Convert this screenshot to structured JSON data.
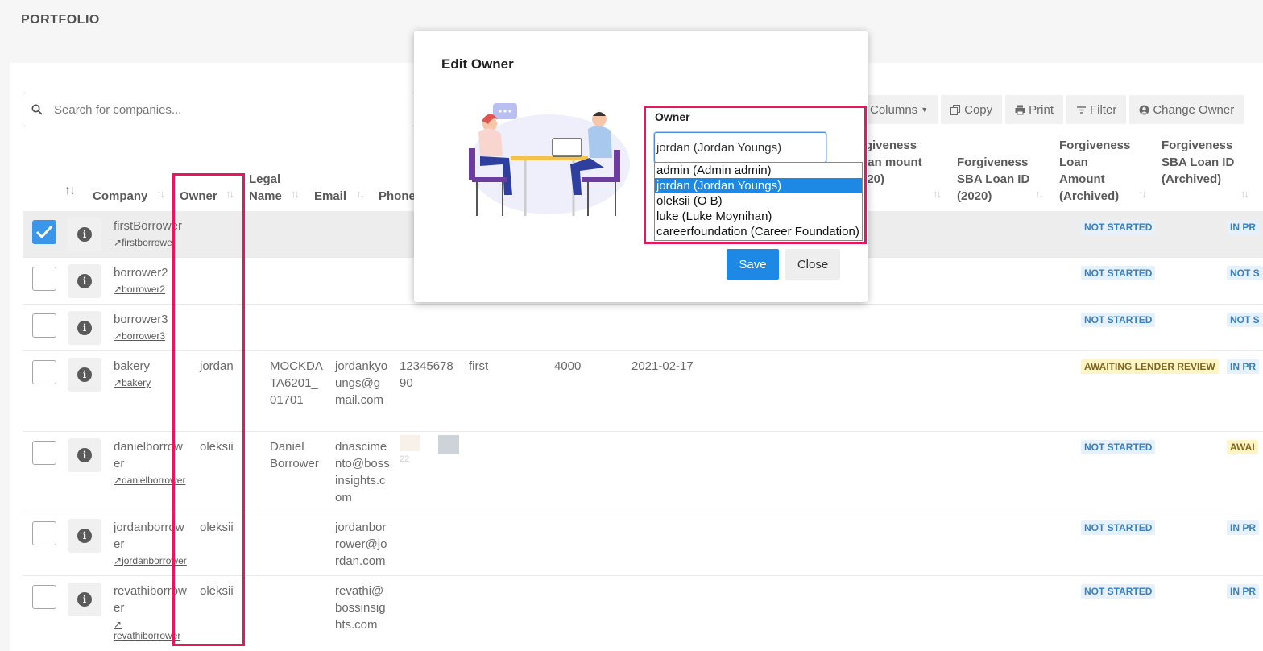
{
  "page": {
    "title": "PORTFOLIO"
  },
  "search": {
    "placeholder": "Search for companies..."
  },
  "toolbar": {
    "columns": "Columns",
    "copy": "Copy",
    "print": "Print",
    "filter": "Filter",
    "change_owner": "Change Owner"
  },
  "headers": {
    "company": "Company",
    "owner": "Owner",
    "legal_name": "Legal Name",
    "email": "Email",
    "phone": "Phone",
    "forgiveness_loan_amount_2020": "rgiveness oan mount 020)",
    "forgiveness_sba_loan_id_2020": "Forgiveness SBA Loan ID (2020)",
    "forgiveness_loan_amount_archived": "Forgiveness Loan Amount (Archived)",
    "forgiveness_sba_loan_id_archived": "Forgiveness SBA Loan ID (Archived)"
  },
  "rows": [
    {
      "company": "firstBorrower",
      "link": "firstborrowe",
      "owner": "",
      "legal_name": "",
      "email": "",
      "phone": "",
      "col6": "",
      "col7": "",
      "col8": "",
      "status1": "NOT STARTED",
      "status2": "IN PR",
      "checked": true
    },
    {
      "company": "borrower2",
      "link": "borrower2",
      "owner": "",
      "legal_name": "",
      "email": "",
      "phone": "",
      "col6": "",
      "col7": "",
      "col8": "",
      "status1": "NOT STARTED",
      "status2": "NOT S",
      "checked": false
    },
    {
      "company": "borrower3",
      "link": "borrower3",
      "owner": "",
      "legal_name": "",
      "email": "",
      "phone": "",
      "col6": "",
      "col7": "",
      "col8": "",
      "status1": "NOT STARTED",
      "status2": "NOT S",
      "checked": false
    },
    {
      "company": "bakery",
      "link": "bakery",
      "owner": "jordan",
      "legal_name": "MOCKDATA6201_01701",
      "email": "jordankyoungs@gmail.com",
      "phone": "1234567890",
      "col6": "first",
      "col7": "4000",
      "col8": "2021-02-17",
      "status1": "AWAITING LENDER REVIEW",
      "status2": "IN PR",
      "checked": false
    },
    {
      "company": "danielborrower",
      "link": "danielborrower",
      "owner": "oleksii",
      "legal_name": "Daniel Borrower",
      "email": "dnascimento@bossinsights.com",
      "phone": "22",
      "col6": "",
      "col7": "",
      "col8": "",
      "status1": "NOT STARTED",
      "status2": "AWAI",
      "checked": false
    },
    {
      "company": "jordanborrower",
      "link": "jordanborrower",
      "owner": "oleksii",
      "legal_name": "",
      "email": "jordanborrower@jordan.com",
      "phone": "",
      "col6": "",
      "col7": "",
      "col8": "",
      "status1": "NOT STARTED",
      "status2": "IN PR",
      "checked": false
    },
    {
      "company": "revathiborrower",
      "link": "revathiborrower",
      "owner": "oleksii",
      "legal_name": "",
      "email": "revathi@bossinsights.com",
      "phone": "",
      "col6": "",
      "col7": "",
      "col8": "",
      "status1": "NOT STARTED",
      "status2": "IN PR",
      "checked": false
    }
  ],
  "modal": {
    "title": "Edit Owner",
    "owner_label": "Owner",
    "owner_value": "jordan (Jordan Youngs)",
    "options": [
      "admin (Admin admin)",
      "jordan (Jordan Youngs)",
      "oleksii (O B)",
      "luke (Luke Moynihan)",
      "careerfoundation (Career Foundation)"
    ],
    "selected_index": 1,
    "save": "Save",
    "close": "Close"
  },
  "colors": {
    "accent": "#1e88e5",
    "highlight": "#e8175d"
  }
}
